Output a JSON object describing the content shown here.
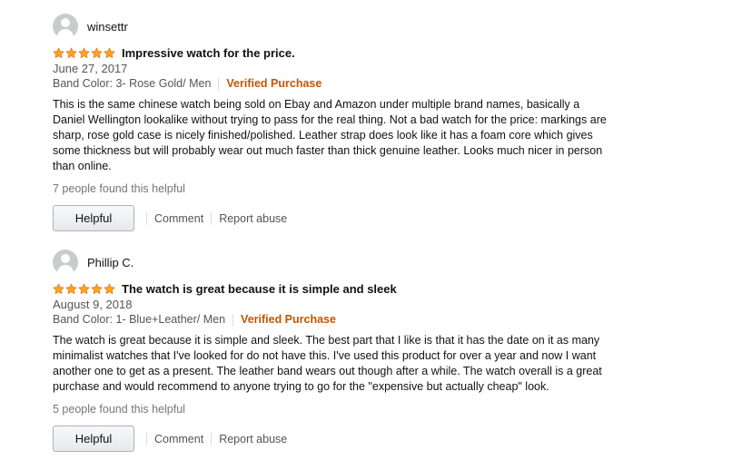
{
  "colors": {
    "star": "#ffa41c",
    "verified": "#c45500",
    "muted": "#555555"
  },
  "reviews": [
    {
      "author": "winsettr",
      "rating": 5,
      "title": "Impressive watch for the price.",
      "date": "June 27, 2017",
      "format": "Band Color: 3- Rose Gold/ Men",
      "verified": "Verified Purchase",
      "body": "This is the same chinese watch being sold on Ebay and Amazon under multiple brand names, basically a Daniel Wellington lookalike without trying to pass for the real thing. Not a bad watch for the price: markings are sharp, rose gold case is nicely finished/polished. Leather strap does look like it has a foam core which gives some thickness but will probably wear out much faster than thick genuine leather. Looks much nicer in person than online.",
      "helpful_count": "7 people found this helpful",
      "helpful_label": "Helpful",
      "comment_label": "Comment",
      "report_label": "Report abuse"
    },
    {
      "author": "Phillip C.",
      "rating": 5,
      "title": "The watch is great because it is simple and sleek",
      "date": "August 9, 2018",
      "format": "Band Color: 1- Blue+Leather/ Men",
      "verified": "Verified Purchase",
      "body": "The watch is great because it is simple and sleek. The best part that I like is that it has the date on it as many minimalist watches that I've looked for do not have this. I've used this product for over a year and now I want another one to get as a present. The leather band wears out though after a while. The watch overall is a great purchase and would recommend to anyone trying to go for the \"expensive but actually cheap\" look.",
      "helpful_count": "5 people found this helpful",
      "helpful_label": "Helpful",
      "comment_label": "Comment",
      "report_label": "Report abuse"
    }
  ]
}
